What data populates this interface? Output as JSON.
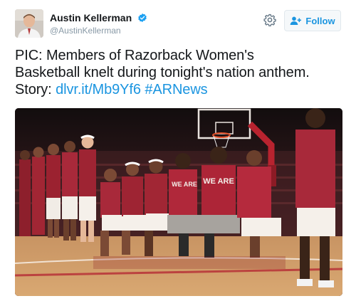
{
  "author": {
    "display_name": "Austin Kellerman",
    "handle": "@AustinKellerman",
    "verified": true
  },
  "actions": {
    "follow_label": "Follow"
  },
  "tweet": {
    "line1": "PIC: Members of Razorback Women's",
    "line2": "Basketball knelt during tonight's nation anthem.",
    "story_label": "Story:",
    "link_text": "dlvr.it/Mb9Yf6",
    "hashtag": "#ARNews"
  },
  "photo": {
    "jersey_text": "WE ARE"
  },
  "colors": {
    "link": "#1b95e0",
    "verified": "#1da1f2",
    "jersey": "#9d2235"
  },
  "icons": {
    "verified": "verified-badge-icon",
    "settings": "gear-icon",
    "follow": "add-user-icon"
  }
}
